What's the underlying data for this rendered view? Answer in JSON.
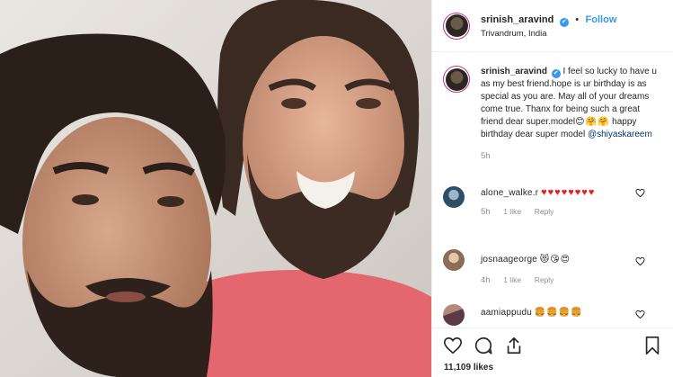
{
  "post": {
    "username": "srinish_aravind",
    "verified_mark": "✔",
    "separator": "•",
    "follow_label": "Follow",
    "location": "Trivandrum, India",
    "photo_alt": "Selfie of two bearded men smiling"
  },
  "caption": {
    "username": "srinish_aravind",
    "text": "I feel so lucky to have u as my best friend.hope is ur birthday is as special as you are. May all of your dreams come true. Thanx for being such a great friend dear super.model",
    "emojis": "😊🤗🤗",
    "text2": " happy birthday dear super model ",
    "mention": "@shiyaskareem",
    "time": "5h"
  },
  "comments": [
    {
      "username": "alone_walke.r",
      "text": "♥♥♥♥♥♥♥♥",
      "time": "5h",
      "likes": "1 like",
      "reply": "Reply",
      "avatar_color": "#3e6b8a"
    },
    {
      "username": "josnaageorge",
      "text": "😻😘😍",
      "time": "4h",
      "likes": "1 like",
      "reply": "Reply",
      "avatar_color": "#b7a18f"
    },
    {
      "username": "aamiappudu",
      "text": "🍔🍔🍔🍔",
      "avatar_color": "#7a5a62"
    }
  ],
  "actions": {
    "like_icon": "heart-icon",
    "comment_icon": "comment-icon",
    "share_icon": "share-icon",
    "save_icon": "bookmark-icon",
    "likes_count": "11,109 likes"
  },
  "colors": {
    "accent": "#3897f0",
    "text": "#262626",
    "muted": "#8e8e8e",
    "heart_red": "#ed1c24"
  }
}
